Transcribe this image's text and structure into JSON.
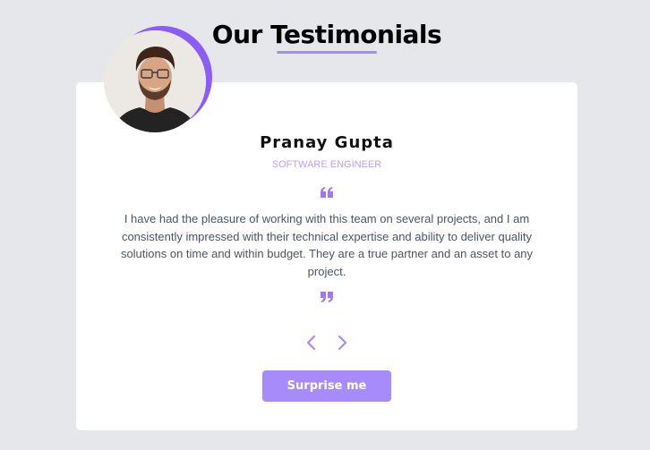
{
  "header": {
    "title": "Our Testimonials",
    "accent_color": "#a78bfa"
  },
  "testimonial": {
    "name": "Pranay Gupta",
    "role": "Software Engineer",
    "quote": "I have had the pleasure of working with this team on several projects, and I am consistently impressed with their technical expertise and ability to deliver quality solutions on time and within budget. They are a true partner and an asset to any project.",
    "avatar_icon": "person-photo",
    "ring_color": "#8b5cf6"
  },
  "icons": {
    "quote_open": "quote-left-icon",
    "quote_close": "quote-right-icon",
    "prev": "chevron-left-icon",
    "next": "chevron-right-icon"
  },
  "actions": {
    "surprise_label": "Surprise me"
  }
}
